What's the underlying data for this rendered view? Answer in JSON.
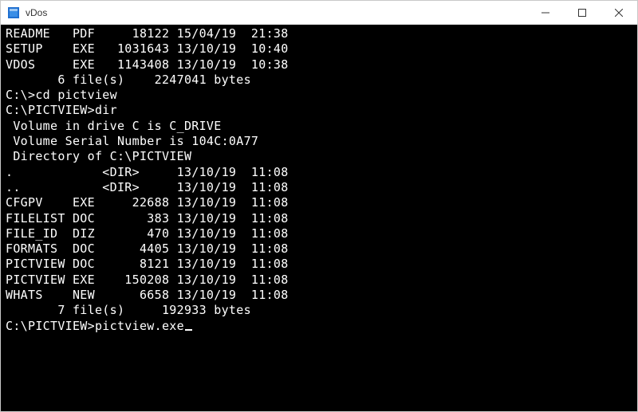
{
  "window": {
    "title": "vDos",
    "icons": {
      "app": "app-icon",
      "minimize": "minimize-icon",
      "maximize": "maximize-icon",
      "close": "close-icon"
    }
  },
  "terminal": {
    "cols": 45,
    "layout": {
      "name_w": 8,
      "ext_w": 3,
      "size_w": 8,
      "date_w": 8,
      "time_w": 5
    },
    "top_listing": [
      {
        "name": "README",
        "ext": "PDF",
        "size": 18122,
        "date": "15/04/19",
        "time": "21:38"
      },
      {
        "name": "SETUP",
        "ext": "EXE",
        "size": 1031643,
        "date": "13/10/19",
        "time": "10:40"
      },
      {
        "name": "VDOS",
        "ext": "EXE",
        "size": 1143408,
        "date": "13/10/19",
        "time": "10:38"
      }
    ],
    "top_summary": {
      "files": 6,
      "bytes": 2247041,
      "files_label": "file(s)",
      "bytes_label": "bytes"
    },
    "cmd1": {
      "prompt": "C:\\>",
      "command": "cd pictview"
    },
    "cmd2": {
      "prompt": "C:\\PICTVIEW>",
      "command": "dir"
    },
    "dir_header": {
      "volume_line": " Volume in drive C is C_DRIVE",
      "serial_line": " Volume Serial Number is 104C:0A77",
      "dirof_line": " Directory of C:\\PICTVIEW"
    },
    "listing2": [
      {
        "name": ".",
        "ext": "",
        "dir": true,
        "date": "13/10/19",
        "time": "11:08"
      },
      {
        "name": "..",
        "ext": "",
        "dir": true,
        "date": "13/10/19",
        "time": "11:08"
      },
      {
        "name": "CFGPV",
        "ext": "EXE",
        "size": 22688,
        "date": "13/10/19",
        "time": "11:08"
      },
      {
        "name": "FILELIST",
        "ext": "DOC",
        "size": 383,
        "date": "13/10/19",
        "time": "11:08"
      },
      {
        "name": "FILE_ID",
        "ext": "DIZ",
        "size": 470,
        "date": "13/10/19",
        "time": "11:08"
      },
      {
        "name": "FORMATS",
        "ext": "DOC",
        "size": 4405,
        "date": "13/10/19",
        "time": "11:08"
      },
      {
        "name": "PICTVIEW",
        "ext": "DOC",
        "size": 8121,
        "date": "13/10/19",
        "time": "11:08"
      },
      {
        "name": "PICTVIEW",
        "ext": "EXE",
        "size": 150208,
        "date": "13/10/19",
        "time": "11:08"
      },
      {
        "name": "WHATS",
        "ext": "NEW",
        "size": 6658,
        "date": "13/10/19",
        "time": "11:08"
      }
    ],
    "summary2": {
      "files": 7,
      "bytes": 192933,
      "files_label": "file(s)",
      "bytes_label": "bytes"
    },
    "cmd3": {
      "prompt": "C:\\PICTVIEW>",
      "command": "pictview.exe"
    }
  }
}
